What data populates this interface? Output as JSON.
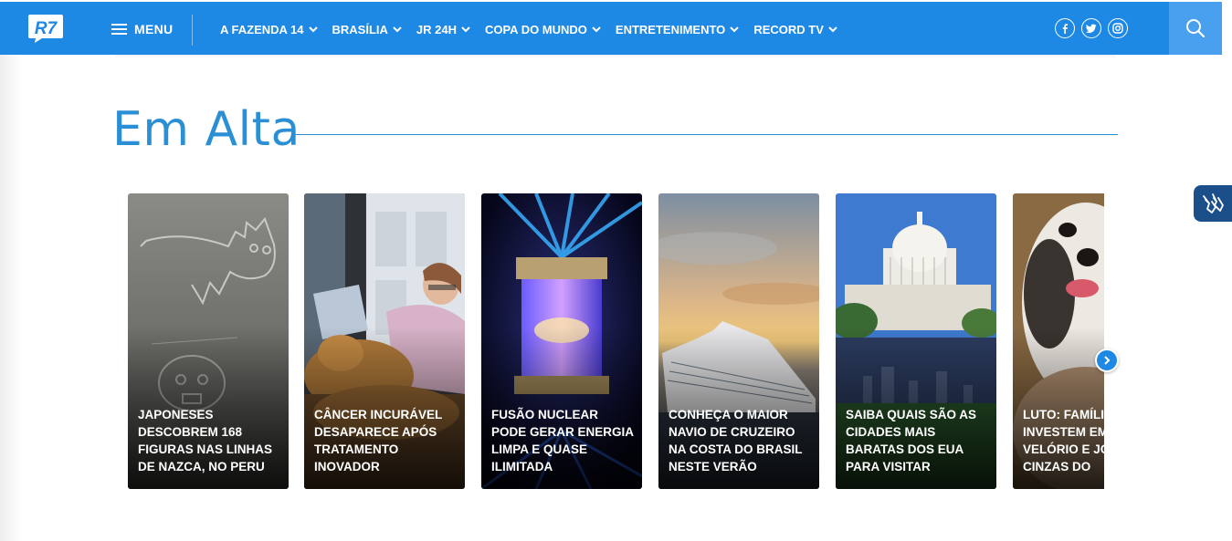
{
  "header": {
    "logo_text": "R7",
    "menu_label": "MENU",
    "nav_items": [
      {
        "label": "A FAZENDA 14"
      },
      {
        "label": "BRASÍLIA"
      },
      {
        "label": "JR 24H"
      },
      {
        "label": "COPA DO MUNDO"
      },
      {
        "label": "ENTRETENIMENTO"
      },
      {
        "label": "RECORD TV"
      }
    ],
    "social_icons": [
      "facebook-icon",
      "twitter-icon",
      "instagram-icon"
    ],
    "search_icon": "search-icon"
  },
  "section": {
    "title": "Em Alta"
  },
  "cards": [
    {
      "caption": "JAPONESES DESCOBREM 168 FIGURAS NAS LINHAS DE NAZCA, NO PERU"
    },
    {
      "caption": "CÂNCER INCURÁVEL DESAPARECE APÓS TRATAMENTO INOVADOR"
    },
    {
      "caption": "FUSÃO NUCLEAR PODE GERAR ENERGIA LIMPA E QUASE ILIMITADA"
    },
    {
      "caption": "CONHEÇA O MAIOR NAVIO DE CRUZEIRO NA COSTA DO BRASIL NESTE VERÃO"
    },
    {
      "caption": "SAIBA QUAIS SÃO AS CIDADES MAIS BARATAS DOS EUA PARA VISITAR"
    },
    {
      "caption": "LUTO: FAMÍLIA INVESTEM EM VELÓRIO E JOIAS AS CINZAS DO"
    }
  ],
  "colors": {
    "brand_blue": "#1e88e5",
    "title_blue": "#2a8fd4",
    "accessibility_blue": "#1b4f8a"
  }
}
